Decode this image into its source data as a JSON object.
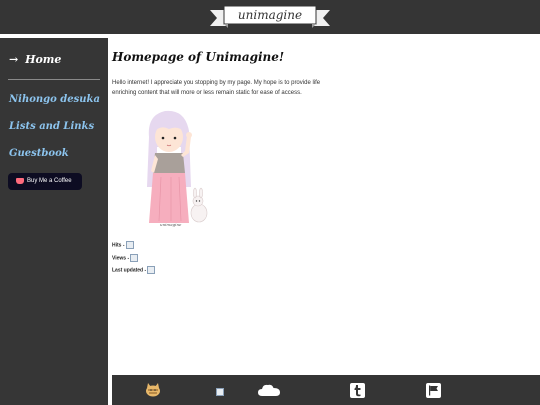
{
  "header": {
    "logo_text": "unimagine"
  },
  "sidebar": {
    "home_arrow": "→",
    "home_label": "Home",
    "links": [
      {
        "label": "Nihongo desuka"
      },
      {
        "label": "Lists and Links"
      },
      {
        "label": "Guestbook"
      }
    ],
    "coffee_label": "Buy Me a Coffee"
  },
  "main": {
    "title": "Homepage of Unimagine!",
    "intro": "Hello internet! I appreciate you stopping by my page. My hope is to provide life enriching content that will more or less remain static for ease of access.",
    "avatar_caption": "unimagine",
    "stats": [
      {
        "label": "Hits -"
      },
      {
        "label": "Views -"
      },
      {
        "label": "Last updated -"
      }
    ]
  },
  "footer": {
    "icons": [
      "neko-atsume-icon",
      "broken-image-icon",
      "cloud-icon",
      "tumblr-icon",
      "flag-icon"
    ]
  },
  "colors": {
    "topbar": "#353535",
    "sidebar": "#363636",
    "nav_link": "#8cc4ee",
    "coffee_bg": "#0d0c22",
    "content_bg": "#ffffff"
  }
}
